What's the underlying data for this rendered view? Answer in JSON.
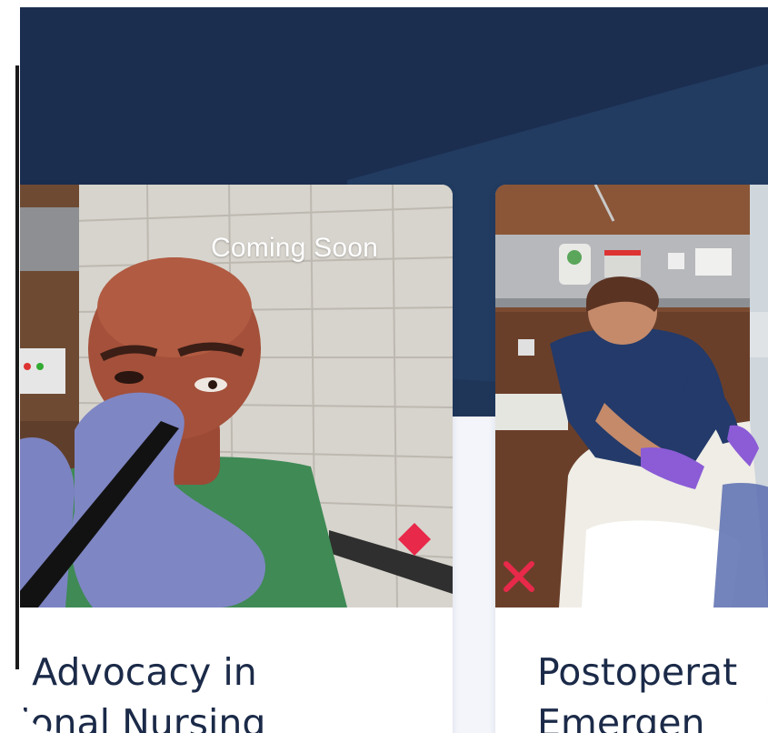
{
  "colors": {
    "hero_navy": "#1b2e50",
    "hero_stripe": "#213a5e",
    "page_bg": "#f3f5fa",
    "card_bg": "#ffffff",
    "title_text": "#1b2a48",
    "accent_marker": "#e8294a"
  },
  "cards": [
    {
      "badge": "Coming Soon",
      "title_line_1": "t Advocacy in",
      "title_line_2": "tional Nursing",
      "image_icon": "vr-patient-scene-image",
      "marker_icon": "red-diamond-marker-icon"
    },
    {
      "title_line_1": "Postoperat",
      "title_line_2": "Emergen",
      "image_icon": "vr-nurse-bedside-scene-image",
      "marker_icon": "red-x-marker-icon"
    }
  ]
}
